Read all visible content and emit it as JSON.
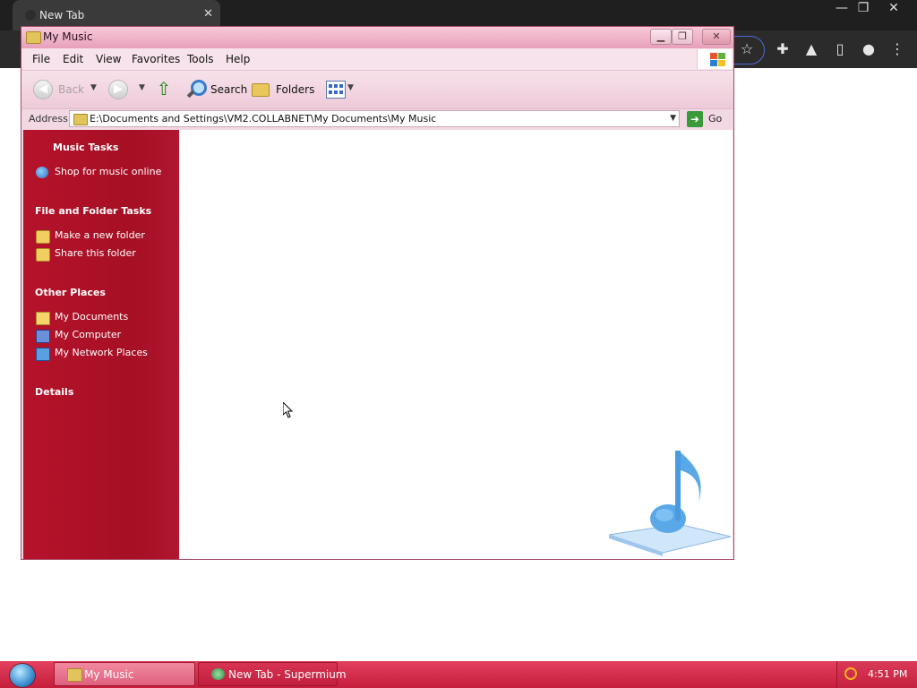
{
  "browser": {
    "tab_title": "New Tab",
    "tab_close": "✕",
    "window_controls": [
      "—",
      "❐",
      "✕"
    ],
    "toolbar_icons": [
      "star-icon",
      "puzzle-icon",
      "flask-icon",
      "sidepanel-icon",
      "profile-icon",
      "menu-icon"
    ]
  },
  "explorer": {
    "title": "My Music",
    "title_buttons": [
      "▁",
      "❐",
      "✕"
    ],
    "menu": [
      "File",
      "Edit",
      "View",
      "Favorites",
      "Tools",
      "Help"
    ],
    "toolbar": {
      "back": "Back",
      "search": "Search",
      "folders": "Folders"
    },
    "address": {
      "label": "Address",
      "path": "E:\\Documents and Settings\\VM2.COLLABNET\\My Documents\\My Music",
      "go": "Go"
    },
    "task_pane": {
      "music_tasks": {
        "heading": "Music Tasks",
        "items": [
          "Shop for music online"
        ]
      },
      "file_folder_tasks": {
        "heading": "File and Folder Tasks",
        "items": [
          "Make a new folder",
          "Share this folder"
        ]
      },
      "other_places": {
        "heading": "Other Places",
        "items": [
          "My Documents",
          "My Computer",
          "My Network Places"
        ]
      },
      "details": {
        "heading": "Details"
      }
    }
  },
  "taskbar": {
    "tasks": [
      "My Music",
      "New Tab - Supermium"
    ],
    "clock": "4:51 PM"
  },
  "colors": {
    "taskbar": "#c61d3c",
    "task_pane": "#a60f24",
    "window_frame": "#f2d8e3"
  }
}
